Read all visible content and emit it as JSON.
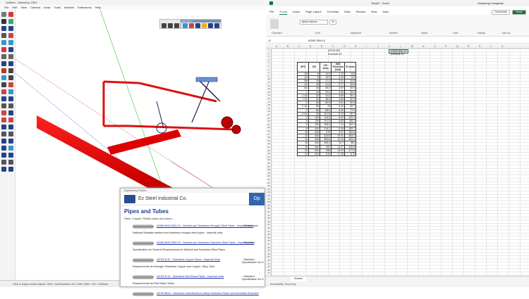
{
  "sketchup": {
    "title": "Untitled - SketchUp 2024",
    "menu": [
      "File",
      "Edit",
      "View",
      "Camera",
      "Draw",
      "Tools",
      "Window",
      "Extensions",
      "Help"
    ],
    "floating_toolbar_title": "EP Tool 2",
    "status": "Click or drag to select objects. Shift = Add/Subtract. Ctrl = Add. Shift + Ctrl = Subtract."
  },
  "toolbox": {
    "window_title": "Engineering Toolbox",
    "company": "Ez Steel Industrial Co.",
    "banner_right": "Op",
    "heading": "Pipes and Tubes",
    "subtitle": "Steel, Copper, Plastic pipes and tubes ...",
    "items": [
      {
        "link": "ASME/ANSI B36.10 - Welded and Seamless Wrought Steel Pipes - Imperial Units",
        "tail": " - Welded and",
        "desc": "National Standard welded and seamless wrought steel pipes - imperial units"
      },
      {
        "link": "ASME/ANSI B36.19 - Welded and Seamless Stainless Steel Pipes - Imperial Units",
        "tail": " - Standard",
        "desc": "Specification for General Requirements for Welded and Seamless Steel Pipes"
      },
      {
        "link": "ASTM B 42 - Seamless Copper Pipes - Imperial Units",
        "tail": " - Standard Specification for S",
        "desc": "Requirements for Wrought Seamless Copper and Copper- Alloy Tube"
      },
      {
        "link": "ASTM B 43 - Seamless Red Brass Pipes - Imperial Units",
        "tail": " - Standard Specification for S",
        "desc": "Requirements for Red Brass Tubes"
      },
      {
        "link": "ASTM B241 - Aluminum and Aluminum-Alloy Seamless Pipes and Seamless Extruded",
        "tail": "",
        "desc": ""
      }
    ]
  },
  "excel": {
    "title": "Book2 - Excel",
    "user": "Sokpheng Sungkeak",
    "tabs": [
      "File",
      "Home",
      "Insert",
      "Page Layout",
      "Formulas",
      "Data",
      "Review",
      "View",
      "Help"
    ],
    "comments_btn": "Comments",
    "share_btn": "Share",
    "ribbon_groups": [
      "Clipboard",
      "Font",
      "Alignment",
      "Number",
      "Styles",
      "Cells",
      "Editing",
      "Add-ins"
    ],
    "font_name": "Aptos Narrow",
    "font_size": "11",
    "cell_ref": "J1",
    "formula": "ASME B36.10",
    "columns": [
      "A",
      "B",
      "C",
      "D",
      "E",
      "F",
      "G",
      "H",
      "I",
      "J",
      "K",
      "L",
      "M",
      "N",
      "O",
      "P",
      "Q",
      "R",
      "S",
      "T",
      "U"
    ],
    "header_left": [
      "ASTM A53",
      "Schedule 40"
    ],
    "header_right": [
      "ASME B36.10",
      "Schedule 40"
    ],
    "table_headers": [
      "NPS",
      "DN",
      "OD (mm)",
      "Wall Thickness (mm)",
      "ID (mm)"
    ],
    "rows": [
      [
        "1/8",
        "6",
        "10.3",
        "1.73",
        "6.8"
      ],
      [
        "1/4",
        "8",
        "13.7",
        "2.24",
        "9.2"
      ],
      [
        "3/8",
        "10",
        "17.1",
        "2.31",
        "12.5"
      ],
      [
        "1/2",
        "15",
        "21.3",
        "2.77",
        "15.8"
      ],
      [
        "3/4",
        "20",
        "26.7",
        "2.87",
        "20.9"
      ],
      [
        "1",
        "25",
        "33.4",
        "3.38",
        "26.6"
      ],
      [
        "1 1/4",
        "32",
        "42.2",
        "3.56",
        "35.1"
      ],
      [
        "1 1/2",
        "40",
        "48.3",
        "3.68",
        "40.9"
      ],
      [
        "2",
        "50",
        "60.3",
        "3.91",
        "52.5"
      ],
      [
        "2 1/2",
        "65",
        "73",
        "5.16",
        "62.7"
      ],
      [
        "3",
        "80",
        "88.9",
        "5.49",
        "77.9"
      ],
      [
        "3 1/2",
        "90",
        "101.6",
        "5.74",
        "90.1"
      ],
      [
        "4",
        "100",
        "114.3",
        "6.02",
        "102.3"
      ],
      [
        "5",
        "125",
        "141.3",
        "6.55",
        "128.2"
      ],
      [
        "6",
        "150",
        "168.3",
        "7.11",
        "154.1"
      ],
      [
        "8",
        "200",
        "219.1",
        "8.18",
        "202.7"
      ],
      [
        "10",
        "250",
        "273",
        "9.27",
        "254.5"
      ],
      [
        "12",
        "300",
        "323.8",
        "10.31",
        "303.2"
      ],
      [
        "14",
        "350",
        "355.6",
        "11.13",
        "333.3"
      ],
      [
        "16",
        "400",
        "406.4",
        "12.7",
        "381"
      ],
      [
        "18",
        "450",
        "457",
        "14.27",
        "428.5"
      ],
      [
        "20",
        "500",
        "508",
        "15.09",
        "477.8"
      ],
      [
        "24",
        "600",
        "610",
        "17.48",
        "575"
      ]
    ],
    "sheet_tab": "Sheet1",
    "status": "Accessibility: Good to go"
  }
}
